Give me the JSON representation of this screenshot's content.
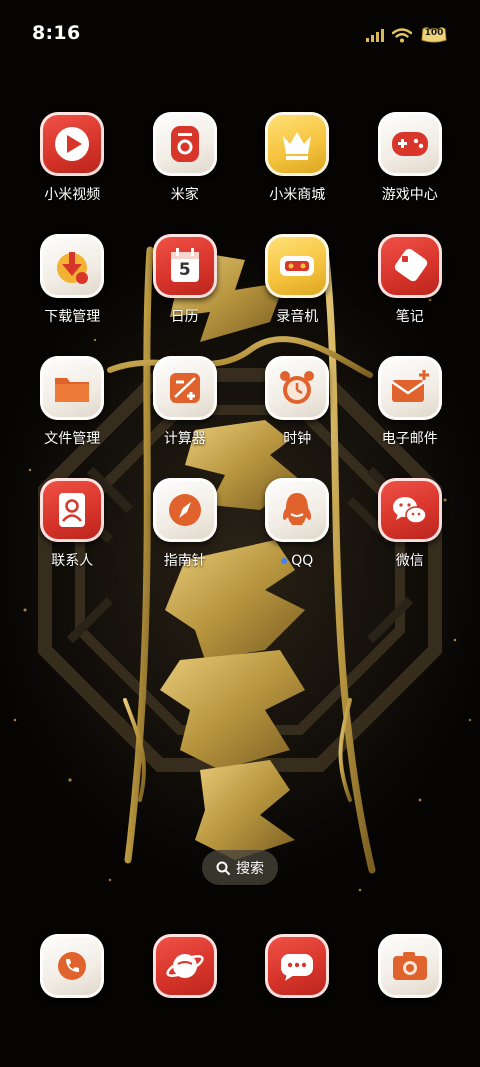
{
  "status_bar": {
    "time": "8:16",
    "battery_level": "100"
  },
  "home_grid": {
    "apps": [
      {
        "label": "小米视频",
        "icon": "play-icon",
        "style": "red"
      },
      {
        "label": "米家",
        "icon": "mijia-icon",
        "style": "white"
      },
      {
        "label": "小米商城",
        "icon": "crown-icon",
        "style": "yellow"
      },
      {
        "label": "游戏中心",
        "icon": "gamepad-icon",
        "style": "white"
      },
      {
        "label": "下载管理",
        "icon": "download-icon",
        "style": "white"
      },
      {
        "label": "日历",
        "icon": "calendar-icon",
        "style": "red",
        "icon_text": "5"
      },
      {
        "label": "录音机",
        "icon": "recorder-icon",
        "style": "yellow"
      },
      {
        "label": "笔记",
        "icon": "note-icon",
        "style": "red"
      },
      {
        "label": "文件管理",
        "icon": "folder-icon",
        "style": "white"
      },
      {
        "label": "计算器",
        "icon": "calculator-icon",
        "style": "white"
      },
      {
        "label": "时钟",
        "icon": "alarm-clock-icon",
        "style": "white"
      },
      {
        "label": "电子邮件",
        "icon": "mail-icon",
        "style": "white"
      },
      {
        "label": "联系人",
        "icon": "contacts-icon",
        "style": "red"
      },
      {
        "label": "指南针",
        "icon": "compass-icon",
        "style": "white"
      },
      {
        "label": "QQ",
        "icon": "qq-penguin-icon",
        "style": "white",
        "new_dot": true
      },
      {
        "label": "微信",
        "icon": "wechat-icon",
        "style": "red"
      }
    ]
  },
  "search": {
    "label": "搜索"
  },
  "dock": {
    "apps": [
      {
        "icon": "phone-icon",
        "style": "white"
      },
      {
        "icon": "browser-planet-icon",
        "style": "red"
      },
      {
        "icon": "messages-icon",
        "style": "red"
      },
      {
        "icon": "camera-icon",
        "style": "white"
      }
    ]
  },
  "colors": {
    "accent_red": "#d8352b",
    "accent_yellow": "#f6c43e",
    "icon_white": "#f1ece4",
    "wallpaper_gold": "#b8963f",
    "wallpaper_black": "#050403"
  }
}
